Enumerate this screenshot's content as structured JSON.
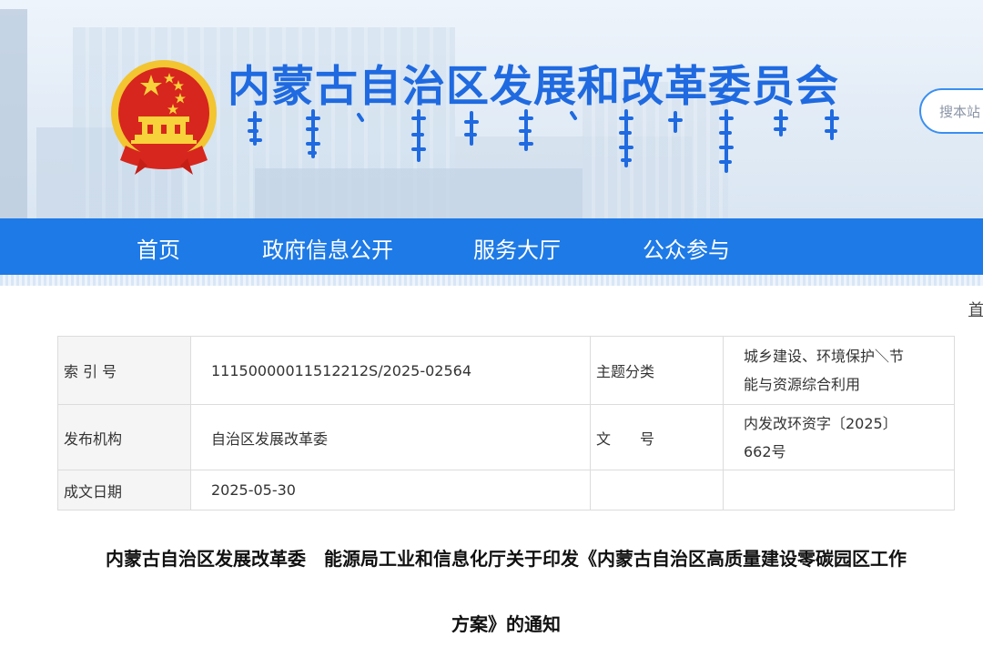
{
  "header": {
    "site_title": "内蒙古自治区发展和改革委员会",
    "search_placeholder": "搜本站",
    "brand_red": "#d7261e",
    "brand_gold": "#f2c531",
    "title_blue": "#1f6ae0"
  },
  "nav": {
    "items": [
      {
        "label": "首页"
      },
      {
        "label": "政府信息公开"
      },
      {
        "label": "服务大厅"
      },
      {
        "label": "公众参与"
      }
    ],
    "bg_color": "#1e7ae6"
  },
  "breadcrumb": {
    "first": "首"
  },
  "meta": {
    "index_label": "索 引 号",
    "index_value": "11150000011512212S/2025-02564",
    "topic_label": "主题分类",
    "topic_value_line1": "城乡建设、环境保护＼节",
    "topic_value_line2": "能与资源综合利用",
    "issuer_label": "发布机构",
    "issuer_value": "自治区发展改革委",
    "docno_label": "文　　号",
    "docno_value_line1": "内发改环资字〔2025〕",
    "docno_value_line2": "662号",
    "date_label": "成文日期",
    "date_value": "2025-05-30"
  },
  "doc": {
    "title_line1": "内蒙古自治区发展改革委　能源局工业和信息化厅关于印发《内蒙古自治区高质量建设零碳园区工作",
    "title_line2": "方案》的通知"
  }
}
